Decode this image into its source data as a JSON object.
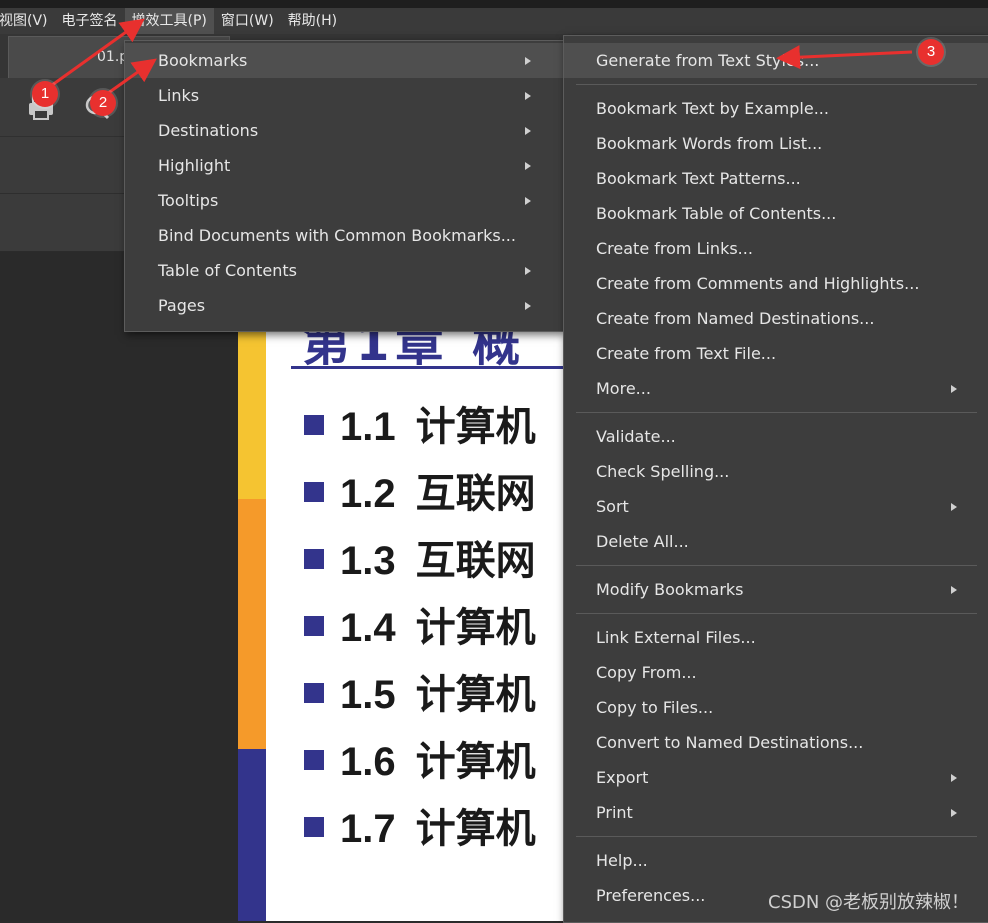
{
  "menubar": {
    "items": [
      {
        "label": "视图(V)"
      },
      {
        "label": "电子签名"
      },
      {
        "label": "增效工具(P)"
      },
      {
        "label": "窗口(W)"
      },
      {
        "label": "帮助(H)"
      }
    ]
  },
  "tab": {
    "label": "01.p"
  },
  "document": {
    "heading": "第1章 概",
    "items": [
      {
        "num": "1.1",
        "text": "计算机"
      },
      {
        "num": "1.2",
        "text": "互联网"
      },
      {
        "num": "1.3",
        "text": "互联网"
      },
      {
        "num": "1.4",
        "text": "计算机"
      },
      {
        "num": "1.5",
        "text": "计算机"
      },
      {
        "num": "1.6",
        "text": "计算机"
      },
      {
        "num": "1.7",
        "text": "计算机"
      }
    ]
  },
  "menu1": {
    "items": [
      {
        "label": "Bookmarks"
      },
      {
        "label": "Links"
      },
      {
        "label": "Destinations"
      },
      {
        "label": "Highlight"
      },
      {
        "label": "Tooltips"
      },
      {
        "label": "Bind Documents with Common Bookmarks..."
      },
      {
        "label": "Table of Contents"
      },
      {
        "label": "Pages"
      }
    ]
  },
  "menu2": {
    "items": [
      {
        "label": "Generate from Text Styles..."
      },
      {
        "label": "Bookmark Text by Example..."
      },
      {
        "label": "Bookmark Words from List..."
      },
      {
        "label": "Bookmark Text Patterns..."
      },
      {
        "label": "Bookmark Table of Contents..."
      },
      {
        "label": "Create from Links..."
      },
      {
        "label": "Create from Comments and Highlights..."
      },
      {
        "label": "Create from Named Destinations..."
      },
      {
        "label": "Create from Text File..."
      },
      {
        "label": "More..."
      },
      {
        "label": "Validate..."
      },
      {
        "label": "Check Spelling..."
      },
      {
        "label": "Sort"
      },
      {
        "label": "Delete All..."
      },
      {
        "label": "Modify Bookmarks"
      },
      {
        "label": "Link External Files..."
      },
      {
        "label": "Copy From..."
      },
      {
        "label": "Copy to Files..."
      },
      {
        "label": "Convert to Named Destinations..."
      },
      {
        "label": "Export"
      },
      {
        "label": "Print"
      },
      {
        "label": "Help..."
      },
      {
        "label": "Preferences..."
      }
    ]
  },
  "annotations": {
    "badge1": "1",
    "badge2": "2",
    "badge3": "3"
  },
  "watermark": "CSDN @老板别放辣椒！",
  "colors": {
    "accent_red": "#e8302e",
    "doc_blue": "#33348c",
    "stripe_yellow": "#f5c431",
    "stripe_orange": "#f59a2a"
  }
}
